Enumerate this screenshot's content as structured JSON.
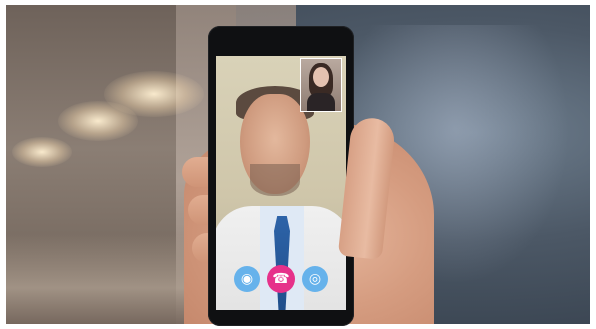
{
  "scene": {
    "description_visible_text": "",
    "icons": {
      "left_button": "camera-icon",
      "center_button": "end-call-icon",
      "right_button": "microphone-icon"
    },
    "colors": {
      "call_button_blue": "#5fafeb",
      "end_call_pink": "#e6318a"
    }
  }
}
